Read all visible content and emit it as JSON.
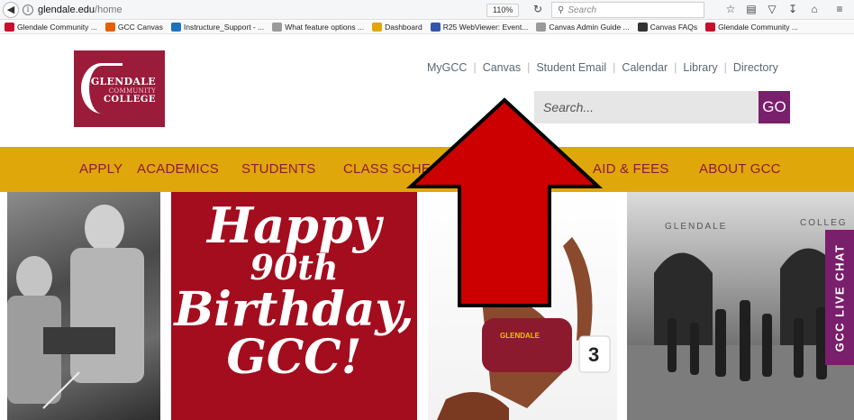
{
  "browser": {
    "url_host": "glendale.edu",
    "url_path": "/home",
    "zoom": "110%",
    "search_placeholder": "Search"
  },
  "bookmarks": [
    {
      "label": "Glendale Community ...",
      "color": "#c8102e"
    },
    {
      "label": "GCC Canvas",
      "color": "#e66000"
    },
    {
      "label": "Instructure_Support - ...",
      "color": "#1e73be"
    },
    {
      "label": "What feature options ...",
      "color": "#9a9a9a"
    },
    {
      "label": "Dashboard",
      "color": "#e0a70a"
    },
    {
      "label": "R25 WebViewer: Event...",
      "color": "#3355aa"
    },
    {
      "label": "Canvas Admin Guide ...",
      "color": "#9a9a9a"
    },
    {
      "label": "Canvas FAQs",
      "color": "#333333"
    },
    {
      "label": "Glendale Community ...",
      "color": "#c8102e"
    }
  ],
  "logo": {
    "line1": "GLENDALE",
    "line2": "COMMUNITY",
    "line3": "COLLEGE"
  },
  "utility_links": [
    "MyGCC",
    "Canvas",
    "Student Email",
    "Calendar",
    "Library",
    "Directory"
  ],
  "site_search": {
    "placeholder": "Search...",
    "button": "GO"
  },
  "nav": [
    "APPLY",
    "ACADEMICS",
    "STUDENTS",
    "CLASS SCHE",
    "AID & FEES",
    "ABOUT GCC"
  ],
  "hero": {
    "birthday_lines": [
      "Happy",
      "90th",
      "Birthday,",
      "GCC!"
    ],
    "building_label_left": "GLENDALE",
    "building_label_right": "COLLEG",
    "jersey_label": "GLENDALE",
    "bib_number": "3"
  },
  "live_chat": "GCC LIVE CHAT",
  "colors": {
    "brand_maroon": "#9b1b3b",
    "nav_gold": "#e0a70a",
    "accent_purple": "#7a1f6b",
    "arrow_red": "#cc0000"
  }
}
